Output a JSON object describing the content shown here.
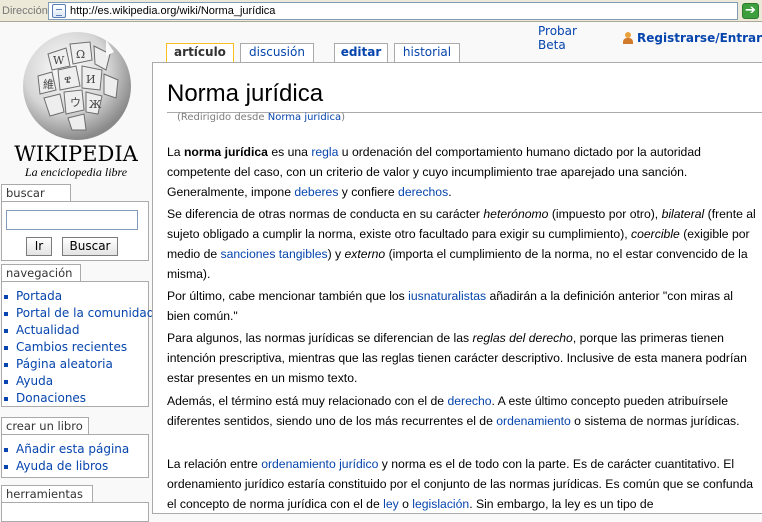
{
  "browser": {
    "address_label": "Dirección",
    "url": "http://es.wikipedia.org/wiki/Norma_jurídica",
    "go_symbol": "➔"
  },
  "logo": {
    "wordmark": "WIKIPEDIA",
    "tagline": "La enciclopedia libre",
    "icon": "wikipedia-globe-icon"
  },
  "search": {
    "heading": "buscar",
    "go_label": "Ir",
    "search_label": "Buscar",
    "input_value": ""
  },
  "navigation": {
    "heading": "navegación",
    "items": [
      "Portada",
      "Portal de la comunidad",
      "Actualidad",
      "Cambios recientes",
      "Página aleatoria",
      "Ayuda",
      "Donaciones"
    ]
  },
  "create_book": {
    "heading": "crear un libro",
    "items": [
      "Añadir esta página",
      "Ayuda de libros"
    ]
  },
  "tools": {
    "heading": "herramientas"
  },
  "personal": {
    "beta": "Probar Beta",
    "login": "Registrarse/Entrar",
    "user_icon": "user-icon"
  },
  "tabs": [
    {
      "label": "artículo",
      "selected": true
    },
    {
      "label": "discusión",
      "selected": false
    },
    {
      "label": "editar",
      "selected": false
    },
    {
      "label": "historial",
      "selected": false
    }
  ],
  "article": {
    "title": "Norma jurídica",
    "redirect_prefix": "(Redirigido desde ",
    "redirect_link": "Norma juridica",
    "redirect_suffix": ")",
    "p1": {
      "a": "La ",
      "b": "norma jurídica",
      "c": " es una ",
      "l1": "regla",
      "d": " u ordenación del comportamiento humano dictado por la autoridad competente del caso, con un criterio de valor y cuyo incumplimiento trae aparejado una sanción. Generalmente, impone ",
      "l2": "deberes",
      "e": " y confiere ",
      "l3": "derechos",
      "f": "."
    },
    "p2": {
      "a": "Se diferencia de otras normas de conducta en su carácter ",
      "i1": "heterónomo",
      "b": " (impuesto por otro), ",
      "i2": "bilateral",
      "c": " (frente al sujeto obligado a cumplir la norma, existe otro facultado para exigir su cumplimiento), ",
      "i3": "coercible",
      "d": " (exigible por medio de ",
      "l1": "sanciones tangibles",
      "e": ") y ",
      "i4": "externo",
      "f": " (importa el cumplimiento de la norma, no el estar convencido de la misma)."
    },
    "p3": {
      "a": "Por último, cabe mencionar también que los ",
      "l1": "iusnaturalistas",
      "b": " añadirán a la definición anterior \"con miras al bien común.\""
    },
    "p4": {
      "a": "Para algunos, las normas jurídicas se diferencian de las ",
      "i1": "reglas del derecho",
      "b": ", porque las primeras tienen intención prescriptiva, mientras que las reglas tienen carácter descriptivo. Inclusive de esta manera podrían estar presentes en un mismo texto."
    },
    "p5": {
      "a": "Además, el término está muy relacionado con el de ",
      "l1": "derecho",
      "b": ". A este último concepto pueden atribuírsele diferentes sentidos, siendo uno de los más recurrentes el de ",
      "l2": "ordenamiento",
      "c": " o sistema de normas jurídicas."
    },
    "p6": {
      "a": "La relación entre ",
      "l1": "ordenamiento jurídico",
      "b": " y norma es el de todo con la parte. Es de carácter cuantitativo. El ordenamiento jurídico estaría constituido por el conjunto de las normas jurídicas. Es común que se confunda el concepto de norma jurídica con el de ",
      "l2": "ley",
      "c": " o ",
      "l3": "legislación",
      "d": ". Sin embargo, la ley es un tipo de"
    }
  }
}
